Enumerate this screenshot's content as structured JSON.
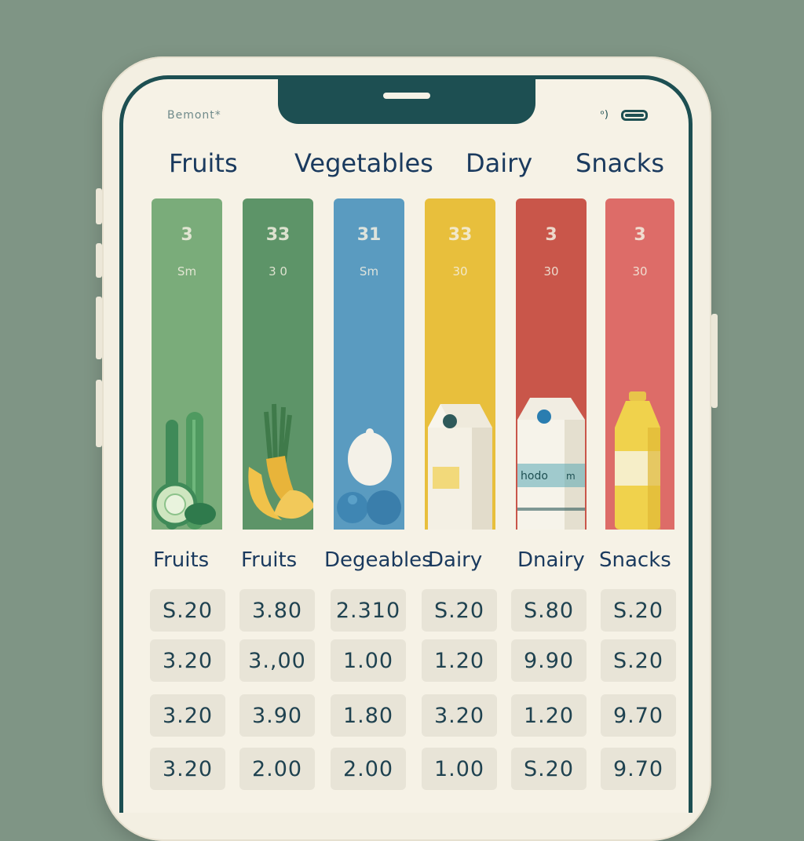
{
  "status_bar": {
    "carrier": "Bemont*",
    "signal_text": "ᵒ)"
  },
  "tabs": [
    "Fruits",
    "Vegetables",
    "Dairy",
    "Snacks"
  ],
  "bars": [
    {
      "value": "3",
      "sub": "Sm",
      "color": "#7aac7a"
    },
    {
      "value": "33",
      "sub": "3 0",
      "color": "#5d9468"
    },
    {
      "value": "31",
      "sub": "Sm",
      "color": "#5a9bc0"
    },
    {
      "value": "33",
      "sub": "30",
      "color": "#e8bf3c"
    },
    {
      "value": "3",
      "sub": "30",
      "color": "#c9564a"
    },
    {
      "value": "3",
      "sub": "30",
      "color": "#dd6c68"
    }
  ],
  "product_labels": {
    "dairy_carton_text": "hodo",
    "dairy_carton_text2": "m"
  },
  "columns": [
    "Fruits",
    "Fruits",
    "Degeables",
    "Dairy",
    "Dnairy",
    "Snacks"
  ],
  "price_rows": [
    [
      "S.20",
      "3.80",
      "2.310",
      "S.20",
      "S.80",
      "S.20"
    ],
    [
      "3.20",
      "3.,00",
      "1.00",
      "1.20",
      "9.90",
      "S.20"
    ],
    [
      "3.20",
      "3.90",
      "1.80",
      "3.20",
      "1.20",
      "9.70"
    ],
    [
      "3.20",
      "2.00",
      "2.00",
      "1.00",
      "S.20",
      "9.70"
    ]
  ]
}
